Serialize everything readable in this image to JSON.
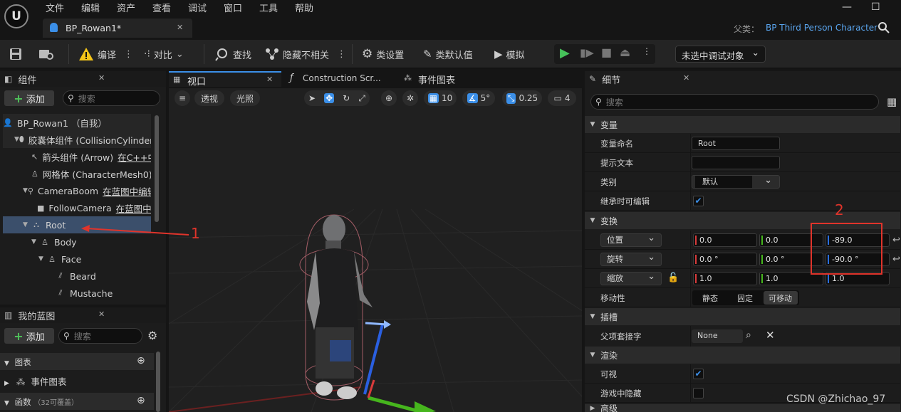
{
  "menu": [
    "文件",
    "编辑",
    "资产",
    "查看",
    "调试",
    "窗口",
    "工具",
    "帮助"
  ],
  "logo_text": "U",
  "window_controls": {
    "minimize": "—",
    "maximize": "☐"
  },
  "document_tab": {
    "title": "BP_Rowan1*",
    "close": "✕"
  },
  "parent_class": {
    "label": "父类：",
    "value": "BP Third Person Character"
  },
  "toolbar": {
    "compile": "编译",
    "diff": "对比",
    "find": "查找",
    "hide_unrelated": "隐藏不相关",
    "class_settings": "类设置",
    "class_defaults": "类默认值",
    "simulate": "模拟",
    "debug_target": "未选中调试对象"
  },
  "components_panel": {
    "title": "组件",
    "add": "添加",
    "search_placeholder": "搜索",
    "tree": [
      {
        "icon": "person-icon",
        "label": "BP_Rowan1 （自我）",
        "link": ""
      },
      {
        "icon": "capsule-icon",
        "label": "胶囊体组件 (CollisionCylinder)",
        "link": ""
      },
      {
        "icon": "arrow-component-icon",
        "label": "箭头组件 (Arrow)",
        "link": "在C++中编辑"
      },
      {
        "icon": "skeletal-mesh-icon",
        "label": "网格体 (CharacterMesh0)",
        "link": ""
      },
      {
        "icon": "spring-arm-icon",
        "label": "CameraBoom",
        "link": "在蓝图中编辑"
      },
      {
        "icon": "camera-icon",
        "label": "FollowCamera",
        "link": "在蓝图中编辑"
      },
      {
        "icon": "scene-root-icon",
        "label": "Root",
        "link": ""
      },
      {
        "icon": "skeletal-mesh-icon",
        "label": "Body",
        "link": ""
      },
      {
        "icon": "skeletal-mesh-icon",
        "label": "Face",
        "link": ""
      },
      {
        "icon": "groom-icon",
        "label": "Beard",
        "link": ""
      },
      {
        "icon": "groom-icon",
        "label": "Mustache",
        "link": ""
      }
    ]
  },
  "blueprint_panel": {
    "title": "我的蓝图",
    "add": "添加",
    "search_placeholder": "搜索",
    "sections": [
      {
        "label": "图表"
      },
      {
        "label": "事件图表"
      },
      {
        "label": "函数",
        "count": "（32可覆盖）"
      }
    ]
  },
  "center_tabs": [
    "视口",
    "Construction Scr...",
    "事件图表"
  ],
  "viewport_toolbar": {
    "perspective": "透视",
    "lit": "光照",
    "grid_snap": "10",
    "rotation_snap": "5°",
    "scale_snap": "0.25",
    "camera_speed": "4"
  },
  "details_panel": {
    "title": "细节",
    "search_placeholder": "搜索",
    "sections": {
      "variable": "变量",
      "transform": "变换",
      "sockets": "插槽",
      "rendering": "渲染",
      "advanced": "高级"
    },
    "variable_name": {
      "label": "变量命名",
      "value": "Root"
    },
    "tooltip": {
      "label": "提示文本",
      "value": ""
    },
    "category": {
      "label": "类别",
      "value": "默认"
    },
    "editable_when_inherited": {
      "label": "继承时可编辑",
      "checked": "✔"
    },
    "location": {
      "label": "位置",
      "x": "0.0",
      "y": "0.0",
      "z": "-89.0"
    },
    "rotation": {
      "label": "旋转",
      "x": "0.0 °",
      "y": "0.0 °",
      "z": "-90.0 °"
    },
    "scale": {
      "label": "缩放",
      "x": "1.0",
      "y": "1.0",
      "z": "1.0"
    },
    "mobility": {
      "label": "移动性",
      "options": [
        "静态",
        "固定",
        "可移动"
      ],
      "selected": "可移动"
    },
    "parent_socket": {
      "label": "父项套接字",
      "value": "None"
    },
    "visible": {
      "label": "可视",
      "checked": "✔"
    },
    "hidden_in_game": {
      "label": "游戏中隐藏",
      "checked": ""
    }
  },
  "annotations": {
    "one": "1",
    "two": "2"
  },
  "watermark": "CSDN @Zhichao_97",
  "colors": {
    "accent": "#3b8fe8",
    "annotation": "#e0342b",
    "play": "#46c25a",
    "selected": "#3b4f6b"
  }
}
